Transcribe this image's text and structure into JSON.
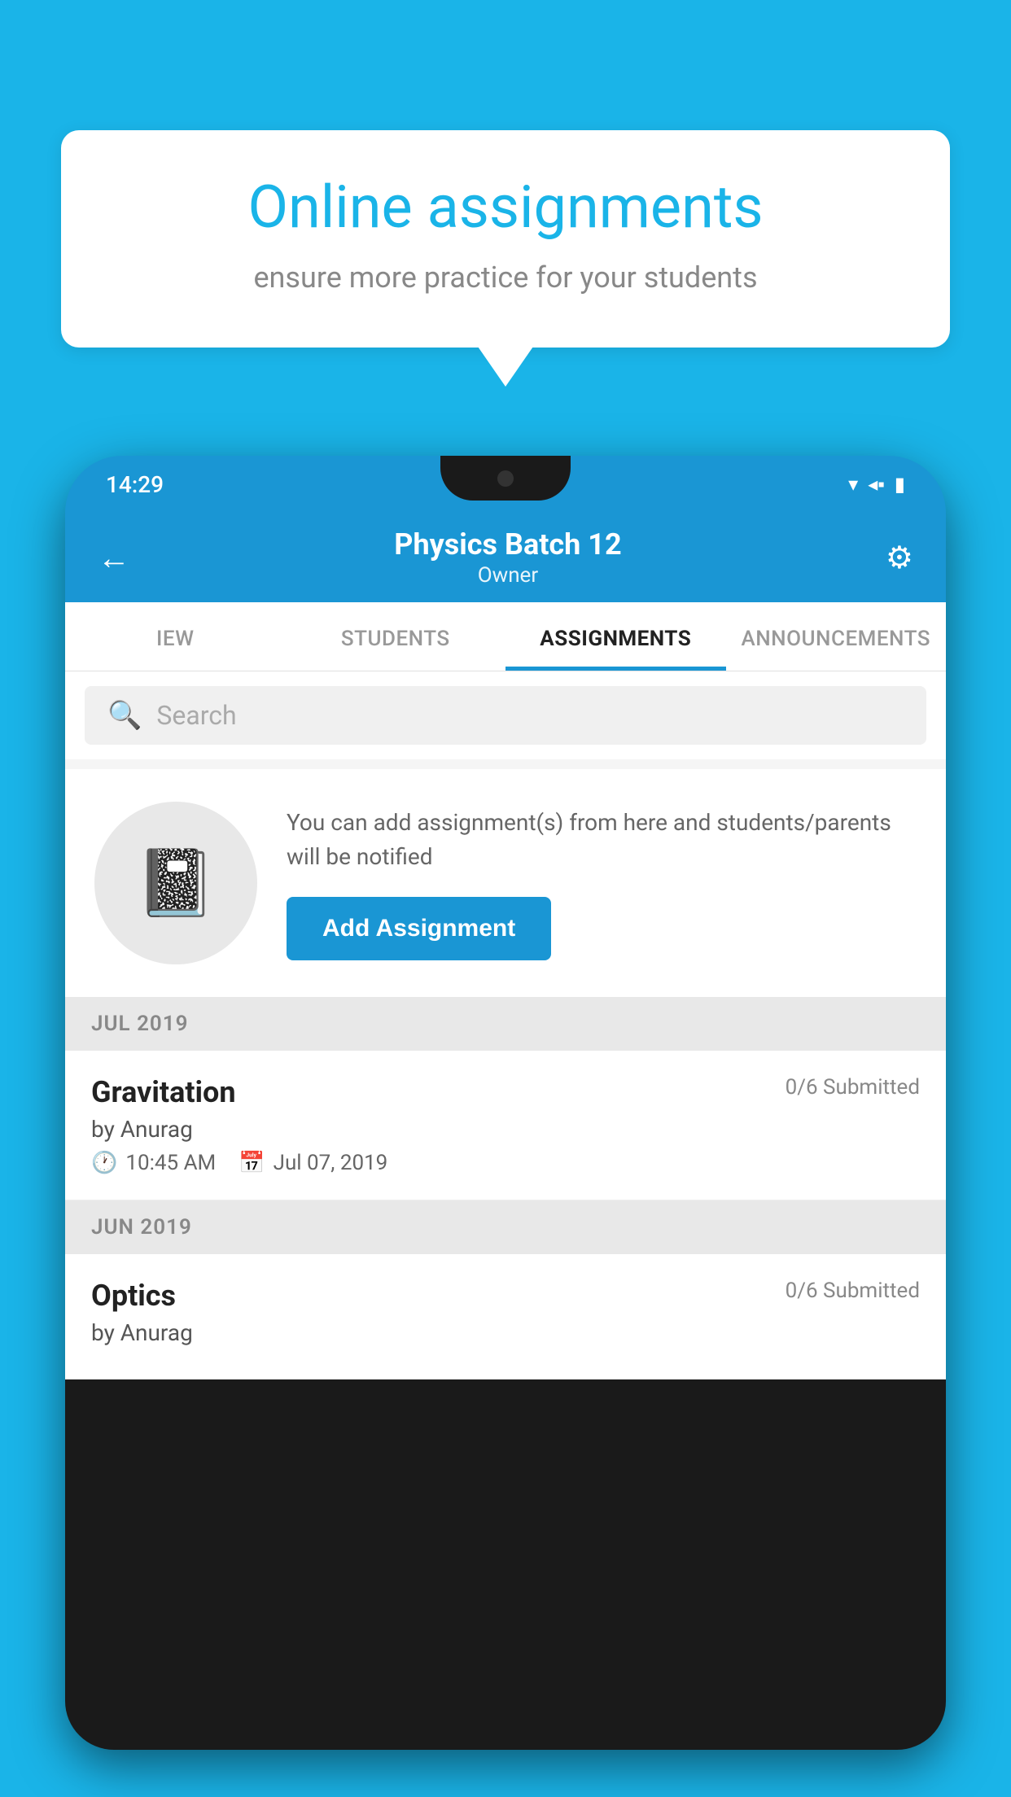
{
  "background": {
    "color": "#1ab4e8"
  },
  "speech_bubble": {
    "title": "Online assignments",
    "subtitle": "ensure more practice for your students"
  },
  "phone": {
    "status_bar": {
      "time": "14:29",
      "icons": [
        "wifi",
        "signal",
        "battery"
      ]
    },
    "header": {
      "title": "Physics Batch 12",
      "subtitle": "Owner",
      "back_label": "←",
      "settings_label": "⚙"
    },
    "tabs": [
      {
        "label": "IEW",
        "active": false
      },
      {
        "label": "STUDENTS",
        "active": false
      },
      {
        "label": "ASSIGNMENTS",
        "active": true
      },
      {
        "label": "ANNOUNCEMENTS",
        "active": false
      }
    ],
    "search": {
      "placeholder": "Search"
    },
    "promo": {
      "description": "You can add assignment(s) from here and students/parents will be notified",
      "button_label": "Add Assignment"
    },
    "sections": [
      {
        "label": "JUL 2019",
        "assignments": [
          {
            "title": "Gravitation",
            "submitted": "0/6 Submitted",
            "author": "by Anurag",
            "time": "10:45 AM",
            "date": "Jul 07, 2019"
          }
        ]
      },
      {
        "label": "JUN 2019",
        "assignments": [
          {
            "title": "Optics",
            "submitted": "0/6 Submitted",
            "author": "by Anurag",
            "time": "",
            "date": ""
          }
        ]
      }
    ]
  }
}
